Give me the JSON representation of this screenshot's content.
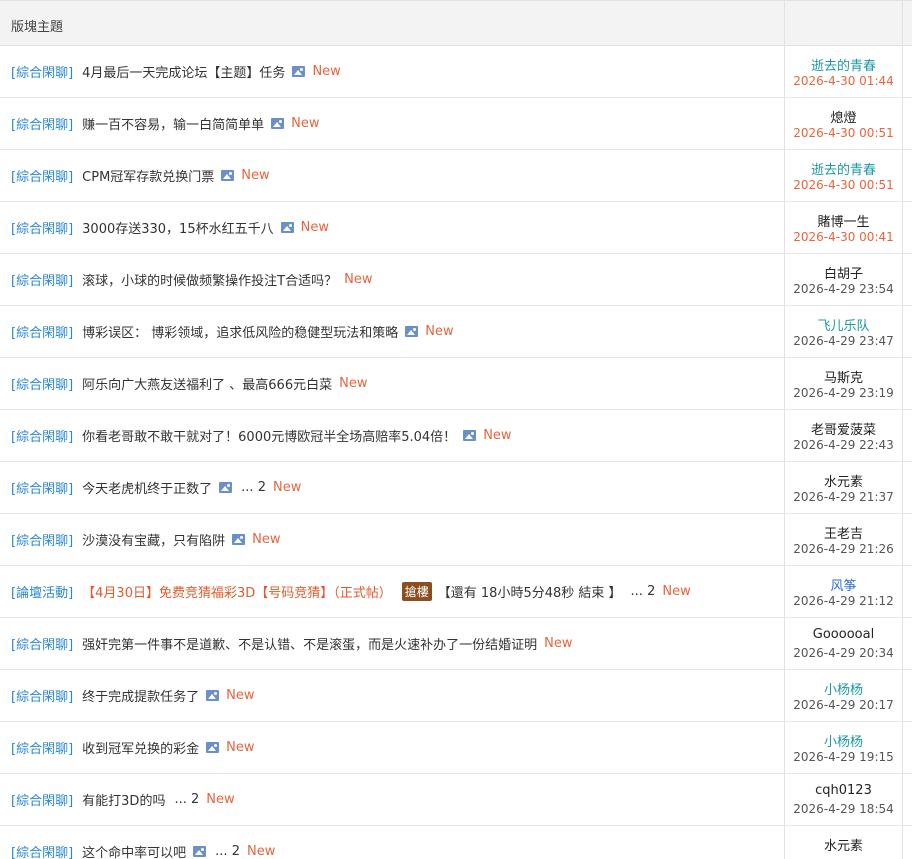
{
  "header": {
    "title": "版塊主題"
  },
  "new_label": "New",
  "threads": [
    {
      "category": "[綜合閑聊]",
      "title": "4月最后一天完成论坛【主题】任务",
      "has_image": true,
      "pages": null,
      "last_user": "逝去的青春",
      "user_style": "teal",
      "last_time": "2026-4-30 01:44",
      "time_style": "red"
    },
    {
      "category": "[綜合閑聊]",
      "title": "赚一百不容易，输一白简简单单",
      "has_image": true,
      "pages": null,
      "last_user": "熄燈",
      "user_style": "default",
      "last_time": "2026-4-30 00:51",
      "time_style": "red"
    },
    {
      "category": "[綜合閑聊]",
      "title": "CPM冠军存款兑换门票",
      "has_image": true,
      "pages": null,
      "last_user": "逝去的青春",
      "user_style": "teal",
      "last_time": "2026-4-30 00:51",
      "time_style": "red"
    },
    {
      "category": "[綜合閑聊]",
      "title": "3000存送330，15杯水红五千八",
      "has_image": true,
      "pages": null,
      "last_user": "賭博一生",
      "user_style": "default",
      "last_time": "2026-4-30 00:41",
      "time_style": "red"
    },
    {
      "category": "[綜合閑聊]",
      "title": "滚球，小球的时候做频繁操作投注T合适吗？",
      "has_image": false,
      "pages": null,
      "last_user": "白胡子",
      "user_style": "default",
      "last_time": "2026-4-29 23:54",
      "time_style": "default"
    },
    {
      "category": "[綜合閑聊]",
      "title": "博彩误区： 博彩领域，追求低风险的稳健型玩法和策略",
      "has_image": true,
      "pages": null,
      "last_user": "飞儿乐队",
      "user_style": "teal",
      "last_time": "2026-4-29 23:47",
      "time_style": "default"
    },
    {
      "category": "[綜合閑聊]",
      "title": "阿乐向广大燕友送福利了 、最高666元白菜",
      "has_image": false,
      "pages": null,
      "last_user": "马斯克",
      "user_style": "default",
      "last_time": "2026-4-29 23:19",
      "time_style": "default"
    },
    {
      "category": "[綜合閑聊]",
      "title": "你看老哥敢不敢干就对了！6000元博欧冠半全场高赔率5.04倍！",
      "has_image": true,
      "pages": null,
      "last_user": "老哥爱菠菜",
      "user_style": "default",
      "last_time": "2026-4-29 22:43",
      "time_style": "default"
    },
    {
      "category": "[綜合閑聊]",
      "title": "今天老虎机终于正数了",
      "has_image": true,
      "pages": "... 2",
      "last_user": "水元素",
      "user_style": "default",
      "last_time": "2026-4-29 21:37",
      "time_style": "default"
    },
    {
      "category": "[綜合閑聊]",
      "title": "沙漠没有宝藏，只有陷阱",
      "has_image": true,
      "pages": null,
      "last_user": "王老吉",
      "user_style": "default",
      "last_time": "2026-4-29 21:26",
      "time_style": "default"
    },
    {
      "category": "[論壇活動]",
      "title": "【4月30日】免费竞猜福彩3D【号码竞猜】（正式帖）",
      "title_red": true,
      "has_image": false,
      "badge": "搶樓",
      "extra": "【還有 18小時5分48秒 結束 】",
      "pages": "... 2",
      "last_user": "风筝",
      "user_style": "blue",
      "last_time": "2026-4-29 21:12",
      "time_style": "default"
    },
    {
      "category": "[綜合閑聊]",
      "title": "强奸完第一件事不是道歉、不是认错、不是滚蛋，而是火速补办了一份结婚证明",
      "has_image": false,
      "pages": null,
      "last_user": "Goooooal",
      "user_style": "default",
      "last_time": "2026-4-29 20:34",
      "time_style": "default"
    },
    {
      "category": "[綜合閑聊]",
      "title": "终于完成提款任务了",
      "has_image": true,
      "pages": null,
      "last_user": "小杨杨",
      "user_style": "teal",
      "last_time": "2026-4-29 20:17",
      "time_style": "default"
    },
    {
      "category": "[綜合閑聊]",
      "title": "收到冠军兑换的彩金",
      "has_image": true,
      "pages": null,
      "last_user": "小杨杨",
      "user_style": "teal",
      "last_time": "2026-4-29 19:15",
      "time_style": "default"
    },
    {
      "category": "[綜合閑聊]",
      "title": "有能打3D的吗",
      "has_image": false,
      "pages": "... 2",
      "last_user": "cqh0123",
      "user_style": "default",
      "last_time": "2026-4-29 18:54",
      "time_style": "default"
    },
    {
      "category": "[綜合閑聊]",
      "title": "这个命中率可以吧",
      "has_image": true,
      "pages": "... 2",
      "last_user": "水元素",
      "user_style": "default",
      "last_time": "",
      "time_style": "default"
    }
  ]
}
